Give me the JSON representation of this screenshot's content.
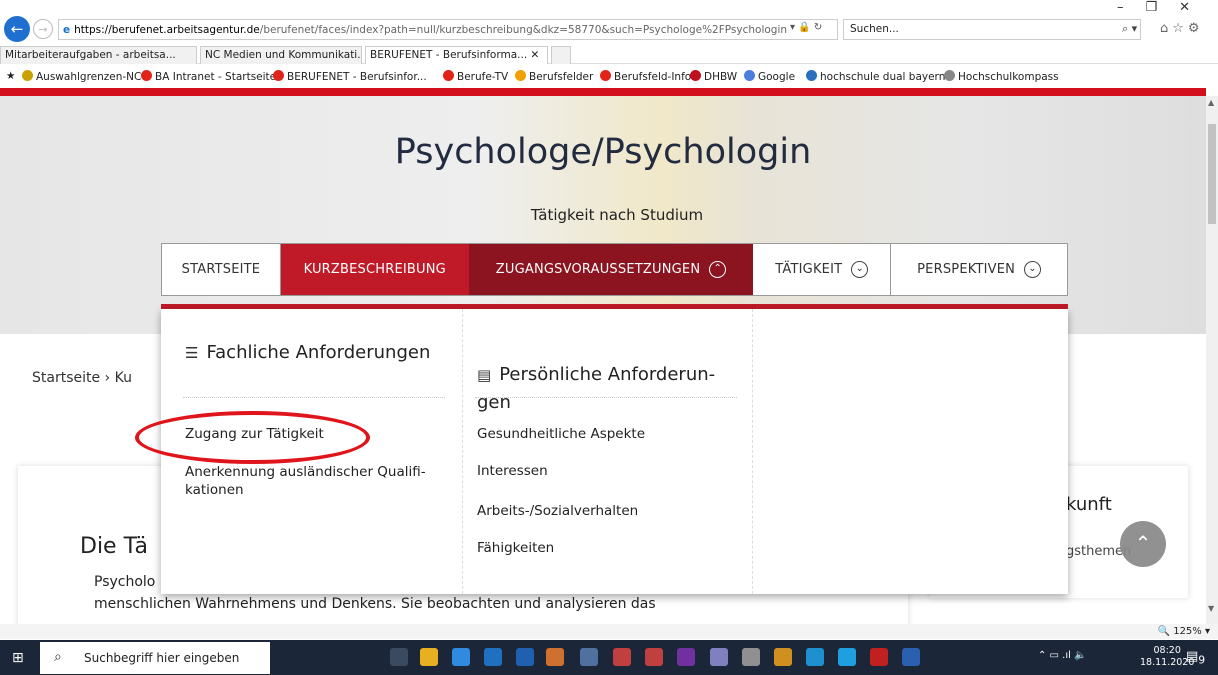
{
  "browser": {
    "window_controls": [
      "–",
      "❐",
      "✕"
    ],
    "url_domain": "https://berufenet.arbeitsagentur.de",
    "url_path": "/berufenet/faces/index?path=null/kurzbeschreibung&dkz=58770&such=Psychologe%2FPsychologin",
    "search_placeholder": "Suchen...",
    "tabs": [
      {
        "label": "Mitarbeiteraufgaben - arbeitsa...",
        "active": false
      },
      {
        "label": "NC Medien und Kommunikati...",
        "active": false
      },
      {
        "label": "BERUFENET - Berufsinforma... ✕",
        "active": true
      }
    ],
    "bookmarks": [
      {
        "label": "Auswahlgrenzen-NC",
        "color": "#c9a100"
      },
      {
        "label": "BA Intranet - Startseite",
        "color": "#e2231a"
      },
      {
        "label": "BERUFENET - Berufsinfor...",
        "color": "#e2231a"
      },
      {
        "label": "Berufe-TV",
        "color": "#e2231a"
      },
      {
        "label": "Berufsfelder",
        "color": "#f0a000"
      },
      {
        "label": "Berufsfeld-Info",
        "color": "#e2231a"
      },
      {
        "label": "DHBW",
        "color": "#c01020"
      },
      {
        "label": "Google",
        "color": "#4a7fe0"
      },
      {
        "label": "hochschule dual bayern",
        "color": "#2a6fc0"
      },
      {
        "label": "Hochschulkompass",
        "color": "#888888"
      }
    ],
    "zoom": "125%"
  },
  "page": {
    "title": "Psychologe/Psychologin",
    "subtitle": "Tätigkeit nach Studium",
    "nav": {
      "start": "STARTSEITE",
      "kurz": "KURZBESCHREIBUNG",
      "zug": "ZUGANGSVORAUSSETZUNGEN",
      "tat": "TÄTIGKEIT",
      "persp": "PERSPEKTIVEN"
    },
    "breadcrumb": "Startseite   ›   Ku",
    "card": {
      "heading": "Die Tä",
      "line1": "Psycholo",
      "line2": "menschlichen Wahrnehmens und Denkens. Sie beobachten und analysieren das",
      "line3": ""
    },
    "side": {
      "heading": "kunft",
      "text": "gsthemen"
    },
    "dropdown": {
      "col1_heading": "Fachliche Anforderungen",
      "col1_links": [
        "Zugang zur Tätigkeit",
        "Anerkennung ausländischer Qualifi-\nkationen"
      ],
      "col2_heading": "Persönliche Anforderun-\ngen",
      "col2_links": [
        "Gesundheitliche Aspekte",
        "Interessen",
        "Arbeits-/Sozialverhalten",
        "Fähigkeiten"
      ]
    },
    "accent_color": "#c01a28",
    "highlight_color": "#e0151b"
  },
  "taskbar": {
    "search_placeholder": "Suchbegriff hier eingeben",
    "time": "08:20",
    "date": "18.11.2020",
    "notification_count": "9"
  }
}
